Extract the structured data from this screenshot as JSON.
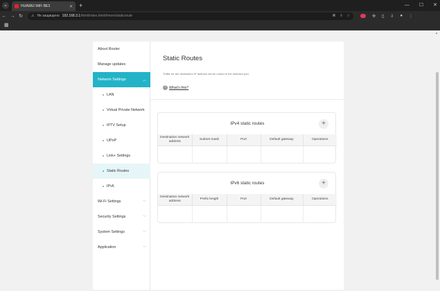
{
  "browser": {
    "tab_title": "HUAWEI WiFi BE3",
    "security_text": "Не защищено",
    "url_host": "192.168.3.1",
    "url_path": "/html/index.html#/more/staticroute",
    "colors": {
      "tab_favicon": "#e0242f",
      "dark_frame": "#1f1f1f"
    }
  },
  "sidebar": {
    "accent_color": "#23b3c8",
    "items": [
      {
        "label": "About Router",
        "level": "top",
        "expandable": false
      },
      {
        "label": "Manage updates",
        "level": "top",
        "expandable": false
      },
      {
        "label": "Network Settings",
        "level": "top",
        "expandable": true,
        "state": "expanded-active"
      },
      {
        "label": "LAN",
        "level": "sub"
      },
      {
        "label": "Virtual Private Network",
        "level": "sub"
      },
      {
        "label": "IPTV Setup",
        "level": "sub"
      },
      {
        "label": "UPnP",
        "level": "sub"
      },
      {
        "label": "Link+ Settings",
        "level": "sub"
      },
      {
        "label": "Static Routes",
        "level": "sub",
        "state": "selected"
      },
      {
        "label": "IPv6",
        "level": "sub"
      },
      {
        "label": "Wi-Fi Settings",
        "level": "top",
        "expandable": true
      },
      {
        "label": "Security Settings",
        "level": "top",
        "expandable": true
      },
      {
        "label": "System Settings",
        "level": "top",
        "expandable": true
      },
      {
        "label": "Application",
        "level": "top",
        "expandable": true
      }
    ]
  },
  "main": {
    "title": "Static Routes",
    "description": "Traffic for the destination IP address will be routed to the selected port.",
    "whats_this": "What's this?",
    "ipv4": {
      "title": "IPv4 static routes",
      "columns": [
        "Destination network address",
        "Subnet mask",
        "Port",
        "Default gateway",
        "Operations"
      ]
    },
    "ipv6": {
      "title": "IPv6 static routes",
      "columns": [
        "Destination network address",
        "Prefix length",
        "Port",
        "Default gateway",
        "Operations"
      ]
    }
  }
}
